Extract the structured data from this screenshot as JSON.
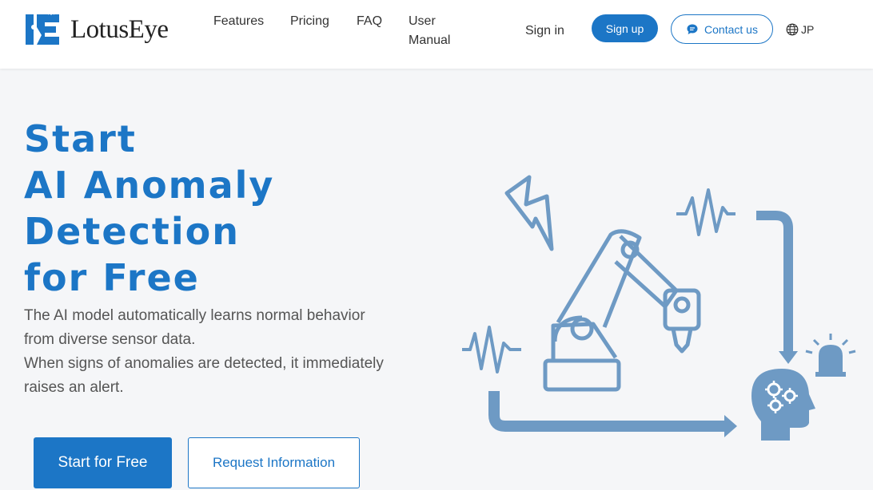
{
  "header": {
    "logo": {
      "text": "LotusEye"
    },
    "nav": {
      "features": "Features",
      "pricing": "Pricing",
      "faq": "FAQ",
      "user_manual": "User Manual"
    },
    "sign_in": "Sign in",
    "sign_up": "Sign up",
    "contact": {
      "label": "Contact us",
      "icon": "chat-bubble-icon"
    },
    "language": {
      "label": "JP",
      "icon": "globe-icon"
    }
  },
  "hero": {
    "headline": [
      "Start",
      "AI Anomaly",
      "Detection",
      "for Free"
    ],
    "description": [
      "The AI model automatically learns normal behavior",
      "from diverse sensor data.",
      "When signs of anomalies are detected, it immediately",
      "raises an alert."
    ],
    "primary_button": "Start for Free",
    "secondary_button": "Request Information"
  },
  "colors": {
    "accent": "#1c76c6",
    "illustration": "#6e9ac4",
    "background": "#f5f6f8"
  },
  "illustration": {
    "icons": [
      "lightning-icon",
      "waveform-icon",
      "robot-arm-icon",
      "arrow-icon",
      "alarm-light-icon",
      "head-gears-icon"
    ]
  }
}
